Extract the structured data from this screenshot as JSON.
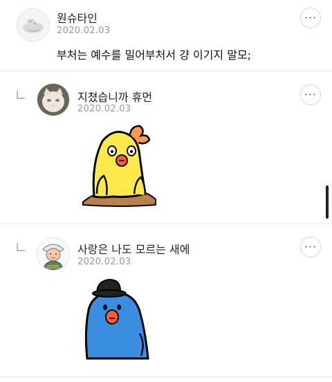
{
  "comments": [
    {
      "author": "원슈타인",
      "date": "2020.02.03",
      "text": "부처는 예수를 밀어부처서 걍 이기지 말모;",
      "avatar_icon": "duck-avatar-icon",
      "more_label": "···"
    },
    {
      "author": "지쳤습니까 휴먼",
      "date": "2020.02.03",
      "avatar_icon": "cat-photo-avatar-icon",
      "sticker_icon": "yellow-chick-sticker-icon",
      "more_label": "···"
    },
    {
      "author": "사랑은 나도 모르는 새에",
      "date": "2020.02.03",
      "avatar_icon": "character-avatar-icon",
      "sticker_icon": "blue-bird-sticker-icon",
      "more_label": "···"
    }
  ],
  "colors": {
    "divider": "#e6e6e6",
    "date": "#999999",
    "sticker_yellow": "#ffe94a",
    "sticker_blue": "#3c8fe0",
    "beak_red": "#ff5a3c"
  }
}
